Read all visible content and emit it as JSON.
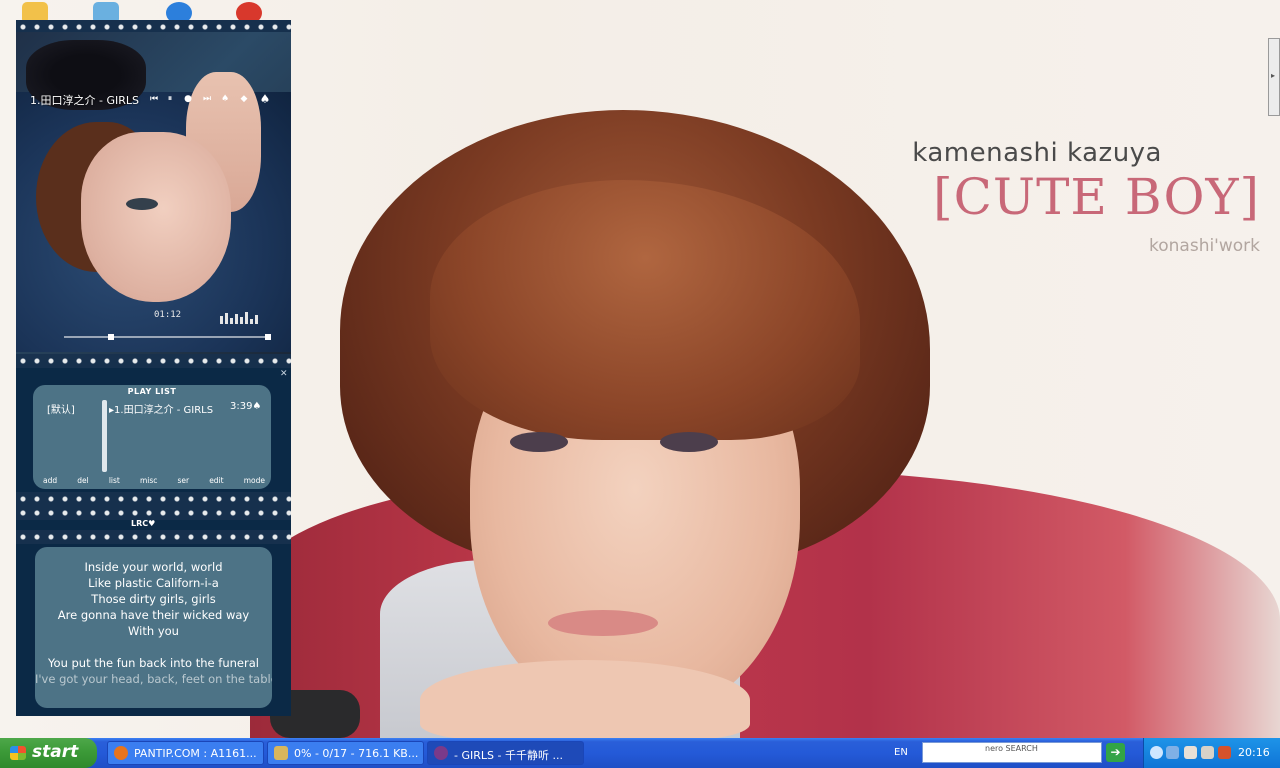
{
  "wallpaper": {
    "name": "kamenashi kazuya",
    "title": "[CUTE BOY]",
    "credit": "konashi'work"
  },
  "player": {
    "now_playing": "1.田口淳之介 - GIRLS",
    "time": "01:12",
    "seek_fraction": 0.23,
    "playlist": {
      "title": "PLAY LIST",
      "group": "[默认]",
      "items": [
        {
          "title": "1.田口淳之介 - GIRLS",
          "duration": "3:39"
        }
      ],
      "buttons": [
        "add",
        "del",
        "list",
        "misc",
        "ser",
        "edit",
        "mode"
      ]
    },
    "lyrics": {
      "title": "LRC",
      "lines": [
        "Inside your world, world",
        "Like plastic Californ-i-a",
        "Those dirty girls, girls",
        "Are gonna have their wicked way",
        "With you",
        "",
        "You put the fun back into the funeral",
        "I've got your head, back, feet on the table"
      ]
    }
  },
  "taskbar": {
    "start_label": "start",
    "tasks": [
      {
        "label": "PANTIP.COM : A1161..."
      },
      {
        "label": "0% - 0/17 - 716.1 KB..."
      },
      {
        "label": "- GIRLS - 千千静听 ..."
      }
    ],
    "language": "EN",
    "search_brand": "nero SEARCH",
    "clock": "20:16"
  },
  "colors": {
    "player_bg": "#0b2946",
    "panel": "#4d7386",
    "title_pink": "#c86878",
    "taskbar_blue": "#245ad8",
    "start_green": "#3c9a38"
  }
}
